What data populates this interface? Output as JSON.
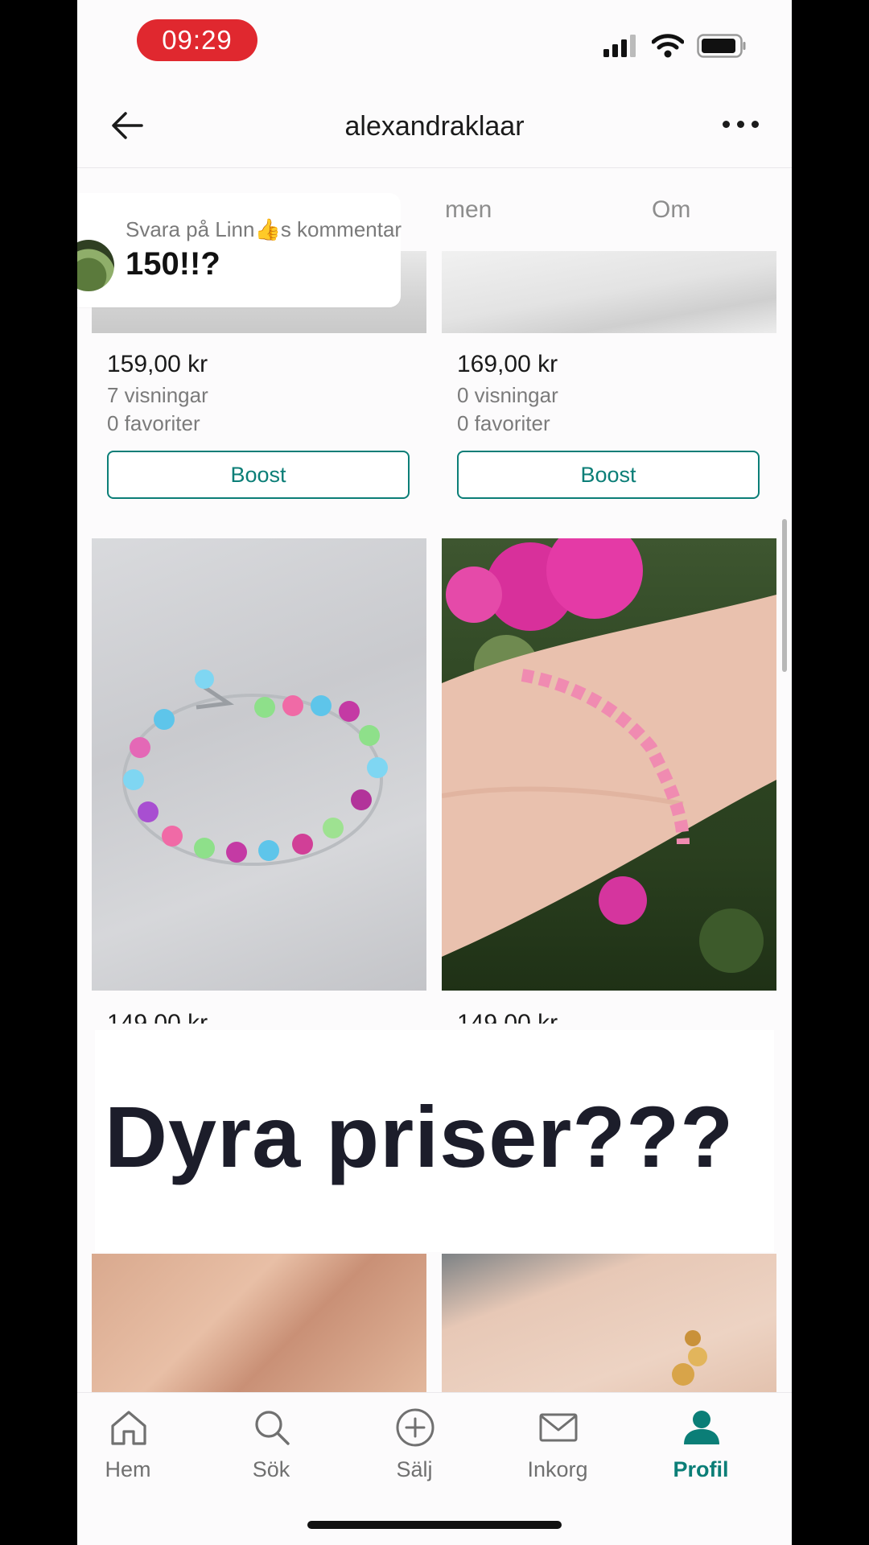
{
  "status": {
    "time": "09:29"
  },
  "header": {
    "title": "alexandraklaar"
  },
  "tabs": {
    "partial_left": "men",
    "about": "Om"
  },
  "comment": {
    "reply_to": "Svara på Linn👍s kommentar",
    "text": "150!!?"
  },
  "items": [
    {
      "price": "159,00 kr",
      "views": "7 visningar",
      "favorites": "0 favoriter",
      "action": "Boost"
    },
    {
      "price": "169,00 kr",
      "views": "0 visningar",
      "favorites": "0 favoriter",
      "action": "Boost"
    },
    {
      "price": "149,00 kr"
    },
    {
      "price": "149,00 kr"
    }
  ],
  "overlay": {
    "caption": "Dyra priser???"
  },
  "tabbar": {
    "items": [
      {
        "label": "Hem",
        "icon": "home-icon"
      },
      {
        "label": "Sök",
        "icon": "search-icon"
      },
      {
        "label": "Sälj",
        "icon": "plus-circle-icon"
      },
      {
        "label": "Inkorg",
        "icon": "mail-icon"
      },
      {
        "label": "Profil",
        "icon": "profile-icon",
        "active": true
      }
    ]
  },
  "colors": {
    "accent": "#0b7e77",
    "time_pill": "#e0282f",
    "overlay_text": "#1c1d2a"
  }
}
